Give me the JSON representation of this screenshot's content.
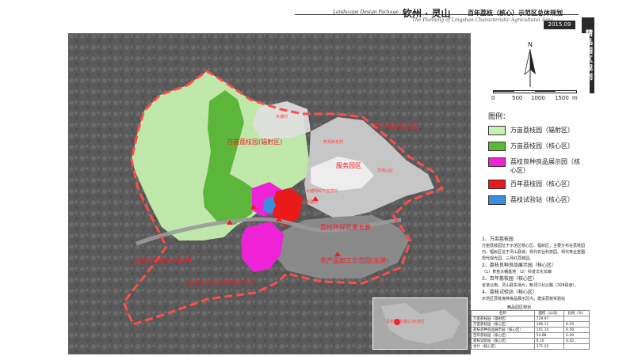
{
  "header": {
    "tag": "Landscape Design Package....",
    "brand": "钦州 · 灵山",
    "title": "百年荔枝（核心）示范区总体规划",
    "subtitle": "The Planning of Lingshan Characteristic Agricultural Area",
    "date": "2015.09"
  },
  "side_tab": {
    "label": "精品园区规划"
  },
  "compass": {
    "label": "N"
  },
  "scale": {
    "ticks": [
      "0",
      "500",
      "1000",
      "1500"
    ],
    "unit": "m"
  },
  "legend": {
    "title": "图例：",
    "items": [
      {
        "label": "万亩荔枝园（辐射区）",
        "color": "#c8f2b0"
      },
      {
        "label": "万亩荔枝园（核心区）",
        "color": "#5cb63a"
      },
      {
        "label": "荔枝良种良品展示园（核心区）",
        "color": "#ee22d6"
      },
      {
        "label": "百年荔枝园（核心区）",
        "color": "#ea1a1a"
      },
      {
        "label": "荔枝试验站（核心区）",
        "color": "#3b8ee0"
      }
    ]
  },
  "notes": [
    {
      "heading": "1、万亩荔枝园",
      "body": "万亩荔枝园位于示范区核心区、辐射区，主要分布在荔枝园内，辐射区位于灵山县城，现代农业科技园、现代林业苗圃、现代观光园、三月红荔枝园。"
    },
    {
      "heading": "2、荔枝良种良品展示园（核心区）",
      "body": "（1）育苗大棚基地   （2）科普文化长廊"
    },
    {
      "heading": "3、百年荔枝园（核心区）",
      "body": "省道以南，灵山县东场片，毗邻江北公路（328县道）。"
    },
    {
      "heading": "4、荔枝试验站（核心区）",
      "body": "示范区荔枝良种良品展示区内，建设荔枝实验站"
    }
  ],
  "map_labels": {
    "zone_radiation": "万亩荔枝园(辐射区)",
    "service_park": "服务园区",
    "village_a": "灰塘村",
    "village_b": "石龙岭东村",
    "village_c": "大塘垌岭下自然村",
    "village_d": "灵地山庄",
    "village_e": "新寨村",
    "park_ne": "百年荔枝观光园",
    "litchi_ring": "荔枝环保花果长廊",
    "processing": "农产品加工示范园(东港)",
    "litchi_corridor": "荔枝环城花果长廊",
    "tech_park": "荔枝技术培训基地示范区",
    "inset_caption": "百年荔枝(核心)示范区"
  },
  "area_table": {
    "title": "精品园区规划",
    "headers": [
      "名称",
      "面积（公顷）",
      "比例（%）"
    ],
    "rows": [
      [
        "万亩荔枝园（辐射区）",
        "729.97",
        ""
      ],
      [
        "万亩荔枝园（核心区）",
        "196.11",
        "6.59"
      ],
      [
        "荔枝良种良品展示园（核心区）",
        "141.14",
        "6.56"
      ],
      [
        "百年荔枝园（核心区）",
        "54.88",
        "2.49"
      ],
      [
        "荔枝试验站（核心区）",
        "9.10",
        "0.42"
      ],
      [
        "合计（核心区）",
        "371.22",
        ""
      ]
    ]
  },
  "colors": {
    "radiation_zone": "#c8f2b0",
    "core_zone": "#5cb63a",
    "showcase": "#ee22d6",
    "centennial": "#ea1a1a",
    "station": "#3b8ee0",
    "boundary": "#ff4d4d"
  }
}
